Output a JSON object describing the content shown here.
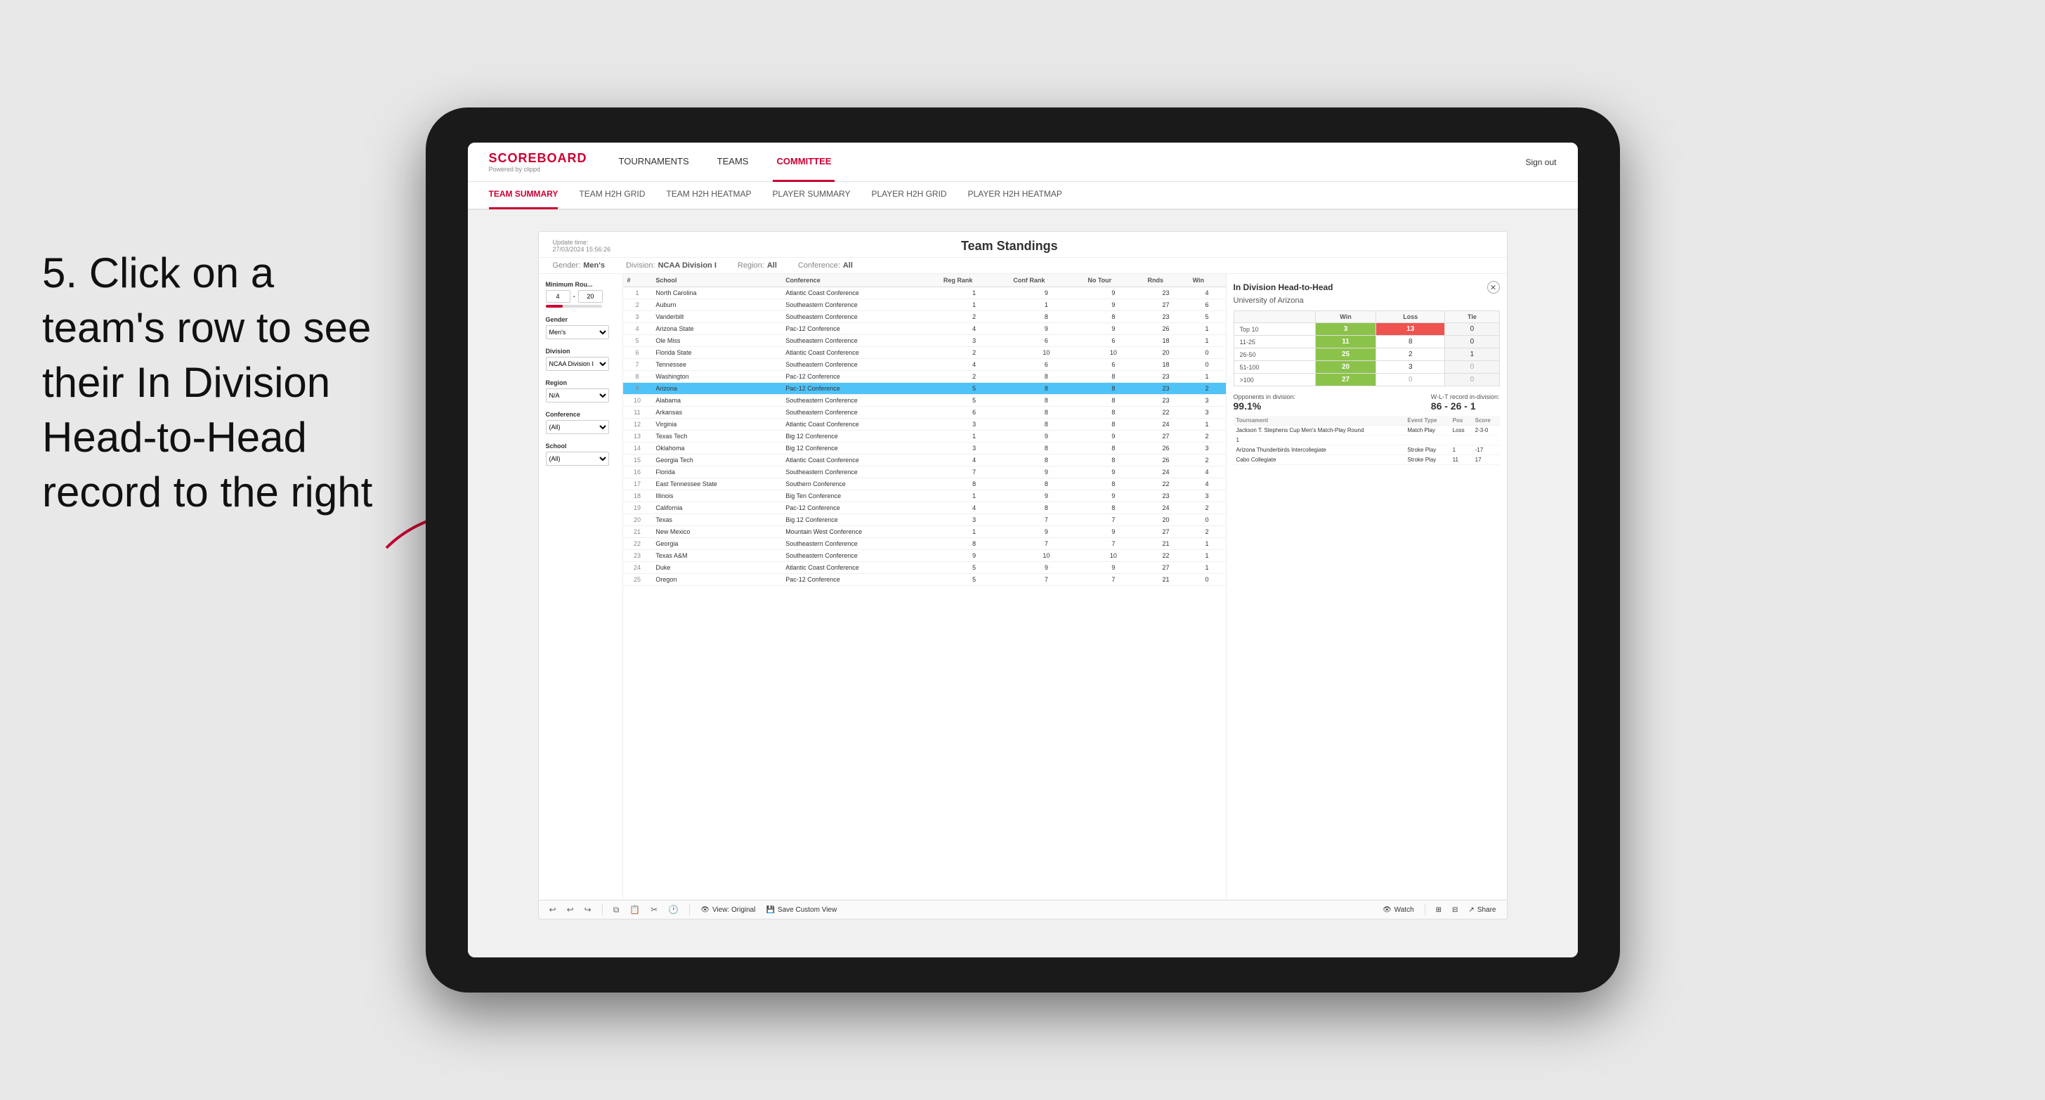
{
  "annotation": {
    "text": "5. Click on a team's row to see their In Division Head-to-Head record to the right"
  },
  "nav": {
    "logo": "SCOREBOARD",
    "logo_sub": "Powered by clippd",
    "sign_out": "Sign out",
    "items": [
      {
        "label": "TOURNAMENTS",
        "active": false
      },
      {
        "label": "TEAMS",
        "active": false
      },
      {
        "label": "COMMITTEE",
        "active": true
      }
    ],
    "sub_items": [
      {
        "label": "TEAM SUMMARY",
        "active": true
      },
      {
        "label": "TEAM H2H GRID",
        "active": false
      },
      {
        "label": "TEAM H2H HEATMAP",
        "active": false
      },
      {
        "label": "PLAYER SUMMARY",
        "active": false
      },
      {
        "label": "PLAYER H2H GRID",
        "active": false
      },
      {
        "label": "PLAYER H2H HEATMAP",
        "active": false
      }
    ]
  },
  "dashboard": {
    "update_time": "Update time:",
    "update_date": "27/03/2024 15:56:26",
    "title": "Team Standings",
    "filters": {
      "gender_label": "Gender:",
      "gender": "Men's",
      "division_label": "Division:",
      "division": "NCAA Division I",
      "region_label": "Region:",
      "region": "All",
      "conference_label": "Conference:",
      "conference": "All"
    }
  },
  "sidebar": {
    "min_rounds_label": "Minimum Rou...",
    "min_value": "4",
    "max_value": "20",
    "gender_label": "Gender",
    "gender_value": "Men's",
    "division_label": "Division",
    "division_value": "NCAA Division I",
    "region_label": "Region",
    "region_value": "N/A",
    "conference_label": "Conference",
    "conference_value": "(All)",
    "school_label": "School",
    "school_value": "(All)"
  },
  "table": {
    "headers": [
      "#",
      "School",
      "Conference",
      "Reg Rank",
      "Conf Rank",
      "No Tour",
      "Rnds",
      "Win"
    ],
    "rows": [
      {
        "num": 1,
        "school": "North Carolina",
        "conf": "Atlantic Coast Conference",
        "reg": 1,
        "conf_rank": 9,
        "notour": 9,
        "rnds": 23,
        "win": 4,
        "highlight": false
      },
      {
        "num": 2,
        "school": "Auburn",
        "conf": "Southeastern Conference",
        "reg": 1,
        "conf_rank": 1,
        "notour": 9,
        "rnds": 27,
        "win": 6,
        "highlight": false
      },
      {
        "num": 3,
        "school": "Vanderbilt",
        "conf": "Southeastern Conference",
        "reg": 2,
        "conf_rank": 8,
        "notour": 8,
        "rnds": 23,
        "win": 5,
        "highlight": false
      },
      {
        "num": 4,
        "school": "Arizona State",
        "conf": "Pac-12 Conference",
        "reg": 4,
        "conf_rank": 9,
        "notour": 9,
        "rnds": 26,
        "win": 1,
        "highlight": false
      },
      {
        "num": 5,
        "school": "Ole Miss",
        "conf": "Southeastern Conference",
        "reg": 3,
        "conf_rank": 6,
        "notour": 6,
        "rnds": 18,
        "win": 1,
        "highlight": false
      },
      {
        "num": 6,
        "school": "Florida State",
        "conf": "Atlantic Coast Conference",
        "reg": 2,
        "conf_rank": 10,
        "notour": 10,
        "rnds": 20,
        "win": 0,
        "highlight": false
      },
      {
        "num": 7,
        "school": "Tennessee",
        "conf": "Southeastern Conference",
        "reg": 4,
        "conf_rank": 6,
        "notour": 6,
        "rnds": 18,
        "win": 0,
        "highlight": false
      },
      {
        "num": 8,
        "school": "Washington",
        "conf": "Pac-12 Conference",
        "reg": 2,
        "conf_rank": 8,
        "notour": 8,
        "rnds": 23,
        "win": 1,
        "highlight": false
      },
      {
        "num": 9,
        "school": "Arizona",
        "conf": "Pac-12 Conference",
        "reg": 5,
        "conf_rank": 8,
        "notour": 8,
        "rnds": 23,
        "win": 2,
        "highlight": true
      },
      {
        "num": 10,
        "school": "Alabama",
        "conf": "Southeastern Conference",
        "reg": 5,
        "conf_rank": 8,
        "notour": 8,
        "rnds": 23,
        "win": 3,
        "highlight": false
      },
      {
        "num": 11,
        "school": "Arkansas",
        "conf": "Southeastern Conference",
        "reg": 6,
        "conf_rank": 8,
        "notour": 8,
        "rnds": 22,
        "win": 3,
        "highlight": false
      },
      {
        "num": 12,
        "school": "Virginia",
        "conf": "Atlantic Coast Conference",
        "reg": 3,
        "conf_rank": 8,
        "notour": 8,
        "rnds": 24,
        "win": 1,
        "highlight": false
      },
      {
        "num": 13,
        "school": "Texas Tech",
        "conf": "Big 12 Conference",
        "reg": 1,
        "conf_rank": 9,
        "notour": 9,
        "rnds": 27,
        "win": 2,
        "highlight": false
      },
      {
        "num": 14,
        "school": "Oklahoma",
        "conf": "Big 12 Conference",
        "reg": 3,
        "conf_rank": 8,
        "notour": 8,
        "rnds": 26,
        "win": 3,
        "highlight": false
      },
      {
        "num": 15,
        "school": "Georgia Tech",
        "conf": "Atlantic Coast Conference",
        "reg": 4,
        "conf_rank": 8,
        "notour": 8,
        "rnds": 26,
        "win": 2,
        "highlight": false
      },
      {
        "num": 16,
        "school": "Florida",
        "conf": "Southeastern Conference",
        "reg": 7,
        "conf_rank": 9,
        "notour": 9,
        "rnds": 24,
        "win": 4,
        "highlight": false
      },
      {
        "num": 17,
        "school": "East Tennessee State",
        "conf": "Southern Conference",
        "reg": 8,
        "conf_rank": 8,
        "notour": 8,
        "rnds": 22,
        "win": 4,
        "highlight": false
      },
      {
        "num": 18,
        "school": "Illinois",
        "conf": "Big Ten Conference",
        "reg": 1,
        "conf_rank": 9,
        "notour": 9,
        "rnds": 23,
        "win": 3,
        "highlight": false
      },
      {
        "num": 19,
        "school": "California",
        "conf": "Pac-12 Conference",
        "reg": 4,
        "conf_rank": 8,
        "notour": 8,
        "rnds": 24,
        "win": 2,
        "highlight": false
      },
      {
        "num": 20,
        "school": "Texas",
        "conf": "Big 12 Conference",
        "reg": 3,
        "conf_rank": 7,
        "notour": 7,
        "rnds": 20,
        "win": 0,
        "highlight": false
      },
      {
        "num": 21,
        "school": "New Mexico",
        "conf": "Mountain West Conference",
        "reg": 1,
        "conf_rank": 9,
        "notour": 9,
        "rnds": 27,
        "win": 2,
        "highlight": false
      },
      {
        "num": 22,
        "school": "Georgia",
        "conf": "Southeastern Conference",
        "reg": 8,
        "conf_rank": 7,
        "notour": 7,
        "rnds": 21,
        "win": 1,
        "highlight": false
      },
      {
        "num": 23,
        "school": "Texas A&M",
        "conf": "Southeastern Conference",
        "reg": 9,
        "conf_rank": 10,
        "notour": 10,
        "rnds": 22,
        "win": 1,
        "highlight": false
      },
      {
        "num": 24,
        "school": "Duke",
        "conf": "Atlantic Coast Conference",
        "reg": 5,
        "conf_rank": 9,
        "notour": 9,
        "rnds": 27,
        "win": 1,
        "highlight": false
      },
      {
        "num": 25,
        "school": "Oregon",
        "conf": "Pac-12 Conference",
        "reg": 5,
        "conf_rank": 7,
        "notour": 7,
        "rnds": 21,
        "win": 0,
        "highlight": false
      }
    ]
  },
  "h2h_panel": {
    "title": "In Division Head-to-Head",
    "school": "University of Arizona",
    "table_headers": [
      "",
      "Win",
      "Loss",
      "Tie"
    ],
    "rows": [
      {
        "range": "Top 10",
        "win": 3,
        "loss": 13,
        "tie": 0,
        "win_class": "cell-green",
        "loss_class": "cell-red"
      },
      {
        "range": "11-25",
        "win": 11,
        "loss": 8,
        "tie": 0,
        "win_class": "cell-green",
        "loss_class": ""
      },
      {
        "range": "26-50",
        "win": 25,
        "loss": 2,
        "tie": 1,
        "win_class": "cell-green",
        "loss_class": ""
      },
      {
        "range": "51-100",
        "win": 20,
        "loss": 3,
        "tie": 0,
        "win_class": "cell-green",
        "loss_class": ""
      },
      {
        "range": ">100",
        "win": 27,
        "loss": 0,
        "tie": 0,
        "win_class": "cell-green",
        "loss_class": "cell-0"
      }
    ],
    "opponents_label": "Opponents in division:",
    "opponents_value": "99.1%",
    "wlt_label": "W-L-T record in-division:",
    "wlt_value": "86 - 26 - 1",
    "tournament_headers": [
      "Tournament",
      "Event Type",
      "Pos",
      "Score"
    ],
    "tournaments": [
      {
        "name": "Jackson T. Stephens Cup Men's Match-Play Round",
        "type": "Match Play",
        "result": "Loss",
        "score": "2-3-0"
      },
      {
        "name": "1",
        "type": "",
        "result": "",
        "score": ""
      },
      {
        "name": "Arizona Thunderbirds Intercollegiate",
        "type": "Stroke Play",
        "result": "1",
        "score": "-17"
      },
      {
        "name": "Cabo Collegiate",
        "type": "Stroke Play",
        "result": "11",
        "score": "17"
      }
    ]
  },
  "toolbar": {
    "view_original": "View: Original",
    "save_custom": "Save Custom View",
    "watch": "Watch",
    "share": "Share"
  }
}
